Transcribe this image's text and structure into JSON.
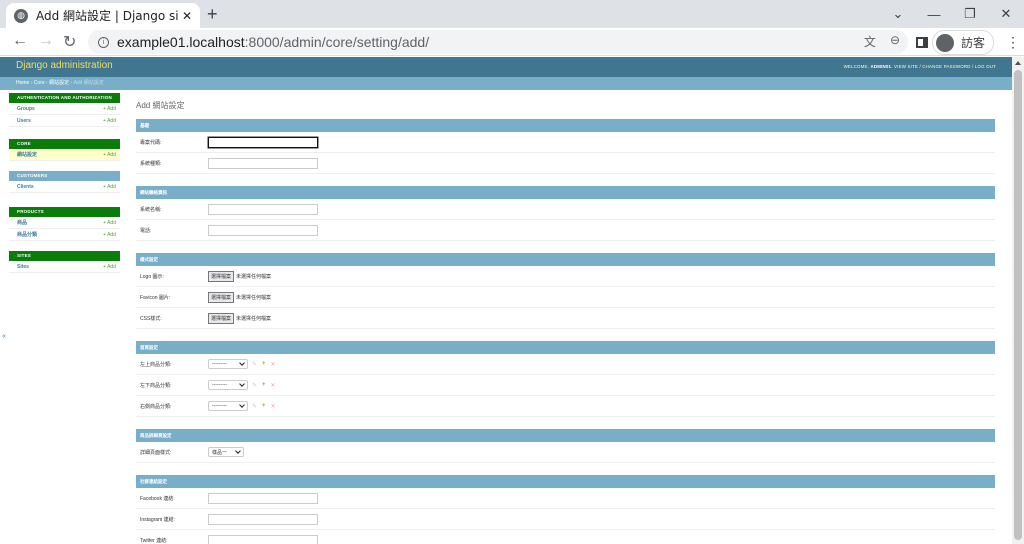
{
  "browser": {
    "tab_title": "Add 網站設定 | Django site admin",
    "tab_close": "✕",
    "new_tab": "+",
    "url_host": "example01.localhost",
    "url_path": ":8000/admin/core/setting/add/",
    "profile_label": "訪客",
    "window_controls": [
      "⌄",
      "—",
      "❐",
      "✕"
    ]
  },
  "header": {
    "brand": "Django administration",
    "welcome": "WELCOME,",
    "username": "ADMIN01",
    "tools": ". VIEW SITE / CHANGE PASSWORD / LOG OUT"
  },
  "breadcrumbs": {
    "home": "Home",
    "app": "Core",
    "model": "網站設定",
    "current": "Add 網站設定",
    "sep": "›"
  },
  "sidebar": {
    "toggle": "«",
    "modules": [
      {
        "title": "AUTHENTICATION AND AUTHORIZATION",
        "rows": [
          {
            "name": "Groups",
            "add": "+ Add"
          },
          {
            "name": "Users",
            "add": "+ Add"
          }
        ]
      },
      {
        "title": "CORE",
        "rows": [
          {
            "name": "網站設定",
            "add": "+ Add"
          }
        ]
      },
      {
        "title": "CUSTOMERS",
        "rows": [
          {
            "name": "Clients",
            "add": "+ Add"
          }
        ]
      },
      {
        "title": "PRODUCTS",
        "rows": [
          {
            "name": "商品",
            "add": "+ Add"
          },
          {
            "name": "商品分類",
            "add": "+ Add"
          }
        ]
      },
      {
        "title": "SITES",
        "rows": [
          {
            "name": "Sites",
            "add": "+ Add"
          }
        ]
      }
    ]
  },
  "content": {
    "title": "Add 網站設定",
    "file_button": "選擇檔案",
    "no_file": "未選擇任何檔案",
    "select_empty": "---------",
    "select_default": "樣品一",
    "fieldsets": [
      {
        "title": "基礎",
        "rows": [
          "專案代碼:",
          "系統種類:"
        ]
      },
      {
        "title": "網站聯絡資訊",
        "rows": [
          "系統名稱:",
          "電話:"
        ]
      },
      {
        "title": "樣式設定",
        "rows": [
          "Logo 圖示:",
          "Favicon 圖片:",
          "CSS樣式:"
        ]
      },
      {
        "title": "首頁設定",
        "rows": [
          "左上商品分類:",
          "左下商品分類:",
          "右側商品分類:"
        ]
      },
      {
        "title": "商品詳細頁設定",
        "rows": [
          "詳細頁面樣式:"
        ]
      },
      {
        "title": "社群連結設定",
        "rows": [
          "Facebook 連結:",
          "Instagram 連結:",
          "Twitter 連結:"
        ]
      }
    ]
  }
}
